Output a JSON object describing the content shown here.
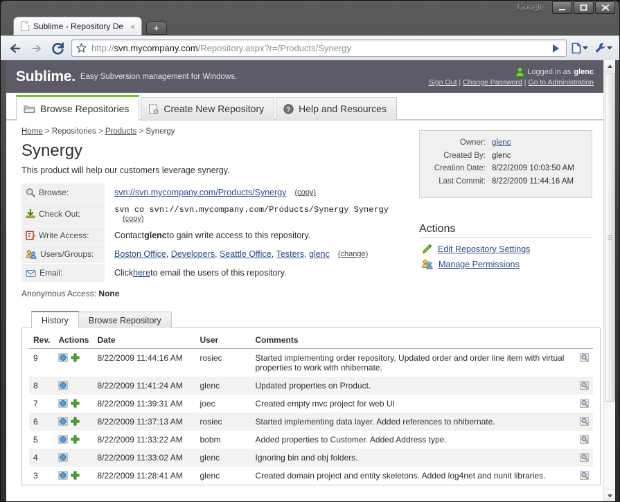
{
  "browser": {
    "window_title_right": "Google",
    "minimize_label": "Minimize",
    "maximize_label": "Maximize",
    "close_label": "Close",
    "tab": {
      "title": "Sublime - Repository Det...",
      "close_label": "×",
      "new_tab_label": "+"
    },
    "nav": {
      "back_label": "Back",
      "forward_label": "Forward",
      "reload_label": "Reload"
    },
    "url": {
      "scheme": "http://",
      "domain": "svn.mycompany.com",
      "path": "/Repository.aspx?r=/Products/Synergy"
    },
    "go_label": "Go",
    "page_menu_label": "Page menu",
    "tools_menu_label": "Tools menu"
  },
  "site": {
    "brand": "Sublime.",
    "tagline": "Easy Subversion management for Windows.",
    "logged_in_prefix": "Logged in as",
    "logged_in_user": "glenc",
    "links": {
      "sign_out": "Sign Out",
      "change_password": "Change Password",
      "administration": "Go to Administration"
    }
  },
  "nav_tabs": [
    {
      "label": "Browse Repositories",
      "icon": "folder-icon",
      "active": true
    },
    {
      "label": "Create New Repository",
      "icon": "new-repo-icon",
      "active": false
    },
    {
      "label": "Help and Resources",
      "icon": "help-icon",
      "active": false
    }
  ],
  "breadcrumb": [
    {
      "label": "Home",
      "link": true
    },
    {
      "label": "Repositories",
      "link": false
    },
    {
      "label": "Products",
      "link": true
    },
    {
      "label": "Synergy",
      "link": false
    }
  ],
  "breadcrumb_separator": ">",
  "repository": {
    "title": "Synergy",
    "description": "This product will help our customers leverage synergy.",
    "browse": {
      "label": "Browse:",
      "icon": "magnifier-icon",
      "url": "svn://svn.mycompany.com/Products/Synergy",
      "copy": "(copy)"
    },
    "checkout": {
      "label": "Check Out:",
      "icon": "download-icon",
      "command": "svn co svn://svn.mycompany.com/Products/Synergy Synergy",
      "copy": "(copy)"
    },
    "write_access": {
      "label": "Write Access:",
      "icon": "edit-icon",
      "text_before": "Contact ",
      "contact": "glenc",
      "text_after": " to gain write access to this repository."
    },
    "users_groups": {
      "label": "Users/Groups:",
      "icon": "users-icon",
      "items": [
        "Boston Office",
        "Developers",
        "Seattle Office",
        "Testers",
        "glenc"
      ],
      "change": "(change)"
    },
    "email": {
      "label": "Email:",
      "icon": "email-icon",
      "text_before": "Click ",
      "link": "here",
      "text_after": " to email the users of this repository."
    },
    "anonymous_access": {
      "label": "Anonymous Access:",
      "value": "None"
    }
  },
  "info_box": [
    {
      "label": "Owner:",
      "value": "glenc",
      "link": true
    },
    {
      "label": "Created By:",
      "value": "glenc",
      "link": false
    },
    {
      "label": "Creation Date:",
      "value": "8/22/2009 10:03:50 AM",
      "link": false
    },
    {
      "label": "Last Commit:",
      "value": "8/22/2009 11:44:16 AM",
      "link": false
    }
  ],
  "actions": {
    "heading": "Actions",
    "items": [
      {
        "label": "Edit Repository Settings",
        "icon": "pencil-icon"
      },
      {
        "label": "Manage Permissions",
        "icon": "users-icon"
      }
    ]
  },
  "history_tabs": [
    {
      "label": "History",
      "active": true
    },
    {
      "label": "Browse Repository",
      "active": false
    }
  ],
  "history_table": {
    "columns": [
      "Rev.",
      "Actions",
      "Date",
      "User",
      "Comments",
      ""
    ],
    "rows": [
      {
        "rev": "9",
        "actions": [
          "view-revision-icon",
          "add-icon"
        ],
        "date": "8/22/2009 11:44:16 AM",
        "user": "rosiec",
        "comment": "Started implementing order repository. Updated order and order line item with virtual properties to work with nhibernate.",
        "view": "inspect-icon"
      },
      {
        "rev": "8",
        "actions": [
          "view-revision-icon"
        ],
        "date": "8/22/2009 11:41:24 AM",
        "user": "glenc",
        "comment": "Updated properties on Product.",
        "view": "inspect-icon"
      },
      {
        "rev": "7",
        "actions": [
          "view-revision-icon",
          "add-icon"
        ],
        "date": "8/22/2009 11:39:31 AM",
        "user": "joec",
        "comment": "Created empty mvc project for web UI",
        "view": "inspect-icon"
      },
      {
        "rev": "6",
        "actions": [
          "view-revision-icon",
          "add-icon"
        ],
        "date": "8/22/2009 11:37:13 AM",
        "user": "rosiec",
        "comment": "Started implementing data layer. Added references to nhibernate.",
        "view": "inspect-icon"
      },
      {
        "rev": "5",
        "actions": [
          "view-revision-icon",
          "add-icon"
        ],
        "date": "8/22/2009 11:33:22 AM",
        "user": "bobm",
        "comment": "Added properties to Customer. Added Address type.",
        "view": "inspect-icon"
      },
      {
        "rev": "4",
        "actions": [
          "view-revision-icon"
        ],
        "date": "8/22/2009 11:33:02 AM",
        "user": "glenc",
        "comment": "Ignoring bin and obj folders.",
        "view": "inspect-icon"
      },
      {
        "rev": "3",
        "actions": [
          "view-revision-icon",
          "add-icon"
        ],
        "date": "8/22/2009 11:28:41 AM",
        "user": "glenc",
        "comment": "Created domain project and entity skeletons. Added log4net and nunit libraries.",
        "view": "inspect-icon"
      }
    ]
  },
  "colors": {
    "header_bg": "#5c5c68",
    "active_tab_accent": "#63c928",
    "link": "#2a4b8d",
    "row_alt": "#f2f2f2"
  }
}
